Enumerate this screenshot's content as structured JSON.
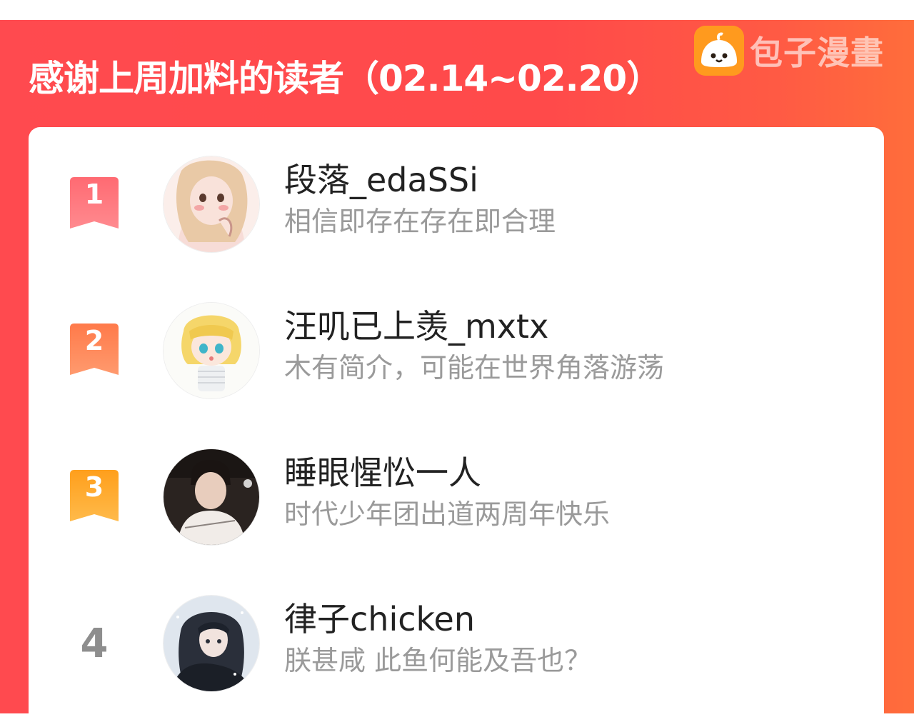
{
  "header": {
    "title": "感谢上周加料的读者（02.14~02.20）",
    "logo_text": "包子漫畫",
    "logo_icon": "baozi-bun-icon"
  },
  "colors": {
    "banner_red": "#ff4a4f",
    "banner_orange": "#ff6d3b",
    "rank1": "#ff5a63",
    "rank2": "#ff7a4a",
    "rank3": "#ff9f1c",
    "rank_plain": "#8e8e8e"
  },
  "readers": [
    {
      "rank": "1",
      "name": "段落_edaSSi",
      "bio": "相信即存在存在即合理",
      "avatar_icon": "illustrated-girl-avatar"
    },
    {
      "rank": "2",
      "name": "汪叽已上羡_mxtx",
      "bio": "木有简介，可能在世界角落游荡",
      "avatar_icon": "chibi-blond-boy-avatar"
    },
    {
      "rank": "3",
      "name": "睡眼惺忪一人",
      "bio": "时代少年团出道两周年快乐",
      "avatar_icon": "photo-boy-avatar"
    },
    {
      "rank": "4",
      "name": "律子chicken",
      "bio": "朕甚咸 此鱼何能及吾也？",
      "avatar_icon": "dark-haired-anime-avatar"
    }
  ]
}
